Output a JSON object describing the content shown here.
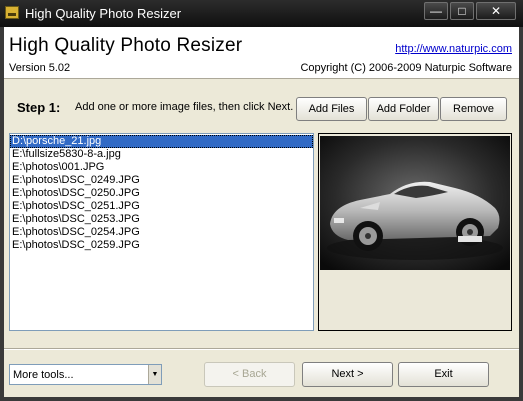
{
  "window": {
    "title": "High Quality Photo Resizer",
    "minimize_glyph": "—",
    "maximize_glyph": "□",
    "close_glyph": "✕"
  },
  "header": {
    "app_title": "High Quality Photo Resizer",
    "version": "Version 5.02",
    "site_link": "http://www.naturpic.com",
    "copyright": "Copyright (C) 2006-2009 Naturpic Software"
  },
  "step": {
    "label": "Step 1:",
    "instructions": "Add one or more image files, then click Next."
  },
  "buttons": {
    "add_files": "Add Files",
    "add_folder": "Add Folder",
    "remove": "Remove",
    "back": "< Back",
    "next": "Next >",
    "exit": "Exit"
  },
  "files": [
    "D:\\porsche_21.jpg",
    "E:\\fullsize5830-8-a.jpg",
    "E:\\photos\\001.JPG",
    "E:\\photos\\DSC_0249.JPG",
    "E:\\photos\\DSC_0250.JPG",
    "E:\\photos\\DSC_0251.JPG",
    "E:\\photos\\DSC_0253.JPG",
    "E:\\photos\\DSC_0254.JPG",
    "E:\\photos\\DSC_0259.JPG"
  ],
  "selected_file_index": 0,
  "tools": {
    "selected": "More tools...",
    "arrow_glyph": "▼"
  },
  "preview_icon": "car-photo",
  "colors": {
    "selection": "#316ac5",
    "link": "#0000cc",
    "window_face": "#ece9d8",
    "titlebar": "#1a1a1a"
  }
}
